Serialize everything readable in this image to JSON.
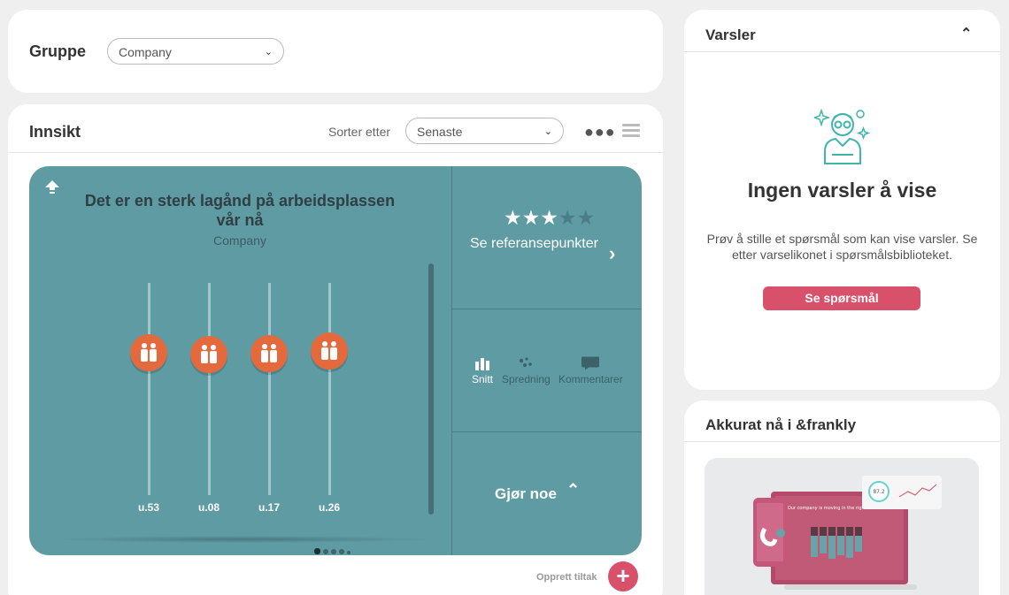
{
  "group": {
    "label": "Gruppe",
    "select_value": "Company"
  },
  "insight": {
    "title": "Innsikt",
    "sort_label": "Sorter etter",
    "sort_value": "Senaste",
    "question": "Det er en sterk lagånd på arbeidsplassen vår nå",
    "question_group": "Company",
    "weeks": [
      {
        "label": "u.53"
      },
      {
        "label": "u.08"
      },
      {
        "label": "u.17"
      },
      {
        "label": "u.26"
      }
    ],
    "rating": {
      "filled": 3,
      "total": 5
    },
    "reference_link": "Se referansepunkter",
    "view_tabs": [
      {
        "label": "Snitt",
        "icon": "bar-chart-icon",
        "active": true
      },
      {
        "label": "Spredning",
        "icon": "scatter-icon",
        "active": false
      },
      {
        "label": "Kommentarer",
        "icon": "comment-icon",
        "active": false
      }
    ],
    "action_label": "Gjør noe",
    "create_action_label": "Opprett tiltak",
    "pages": 5,
    "current_page": 1
  },
  "alerts": {
    "title": "Varsler",
    "empty_title": "Ingen varsler å vise",
    "empty_desc": "Prøv å stille et spørsmål som kan vise varsler. Se etter varselikonet i spørsmålsbiblioteket.",
    "button_label": "Se spørsmål"
  },
  "now": {
    "title": "Akkurat nå i &frankly",
    "promo_text": "Our company is moving in the right direction",
    "promo_score": "87.2"
  },
  "colors": {
    "teal": "#5f9ba3",
    "accent": "#d9506a",
    "marker": "#e46a3d"
  }
}
